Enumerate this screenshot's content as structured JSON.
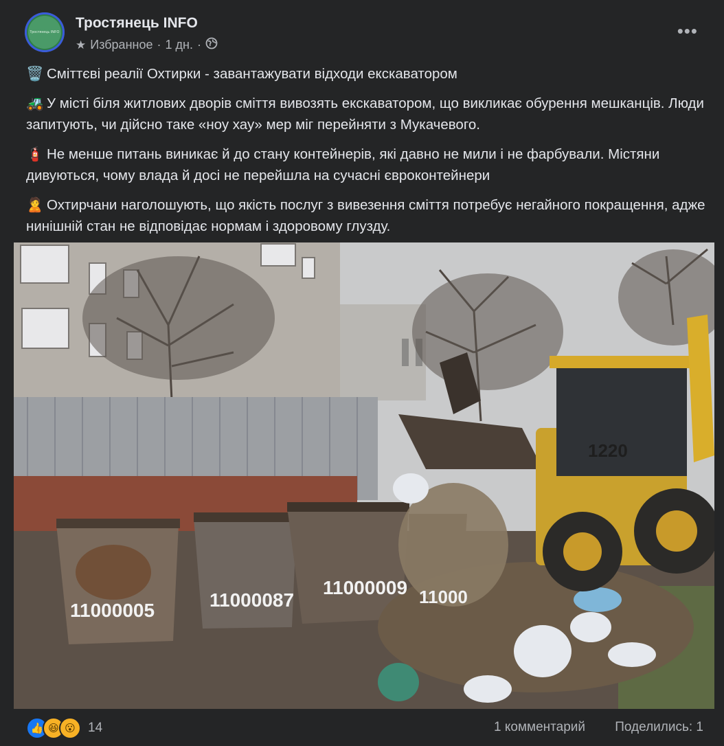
{
  "post": {
    "page_name": "Тростянець INFO",
    "meta": {
      "favorite": "Избранное",
      "separator": "·",
      "time": "1 дн.",
      "visibility_icon": "globe-icon"
    },
    "more_icon": "more-options-icon",
    "avatar_text": "Тростянець INFO",
    "paragraphs": [
      {
        "emoji": "🗑️",
        "text": "Сміттєві реалії Охтирки - завантажувати відходи екскаватором"
      },
      {
        "emoji": "🚜",
        "text": "У місті біля житлових дворів сміття вивозять екскаватором, що викликає обурення мешканців. Люди запитують, чи дійсно таке «ноу хау» мер міг перейняти з Мукачевого."
      },
      {
        "emoji": "🧯",
        "text": "Не менше питань виникає й до стану контейнерів, які давно не мили і не фарбували. Містяни дивуються, чому влада й досі не перейшла на сучасні євроконтейнери"
      },
      {
        "emoji": "🙎",
        "text": "Охтирчани наголошують, що якість послуг з вивезення сміття потребує негайного покращення, адже нинішній стан не відповідає нормам і здоровому глузду."
      }
    ],
    "photo": {
      "container_numbers": [
        "11000005",
        "11000087",
        "11000009",
        "11000"
      ],
      "loader_label": "1220"
    },
    "footer": {
      "reactions": [
        "like-icon",
        "haha-icon",
        "wow-icon"
      ],
      "reaction_count": "14",
      "comments": "1 комментарий",
      "shares": "Поделились: 1"
    }
  },
  "colors": {
    "background": "#242526",
    "text_primary": "#e4e6eb",
    "text_secondary": "#b0b3b8",
    "like_blue": "#1877f2"
  }
}
